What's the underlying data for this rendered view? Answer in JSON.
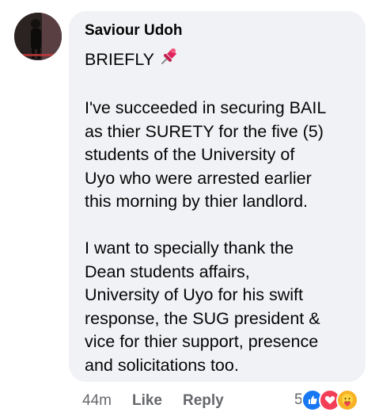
{
  "comment": {
    "author": "Saviour Udoh",
    "heading": "BRIEFLY",
    "heading_icon": "pushpin-icon",
    "paragraph1": [
      "I've succeeded in securing BAIL",
      "as thier SURETY for the five (5)",
      "students of the University of",
      "Uyo who were arrested earlier",
      "this morning by thier landlord."
    ],
    "paragraph2": [
      "I want to specially thank the",
      "Dean students affairs,",
      "University of Uyo for his swift",
      "response, the SUG president &",
      "vice for thier support, presence",
      "and solicitations too."
    ]
  },
  "actions": {
    "time": "44m",
    "like_label": "Like",
    "reply_label": "Reply"
  },
  "reactions": {
    "count": "5",
    "icons": [
      "like-icon",
      "love-icon",
      "care-icon"
    ],
    "colors": {
      "like": "#1877f2",
      "love": "#f33e58",
      "care": "#f7b125"
    }
  },
  "colors": {
    "bubble": "#f0f2f5",
    "meta_text": "#65676b",
    "text": "#050505"
  }
}
